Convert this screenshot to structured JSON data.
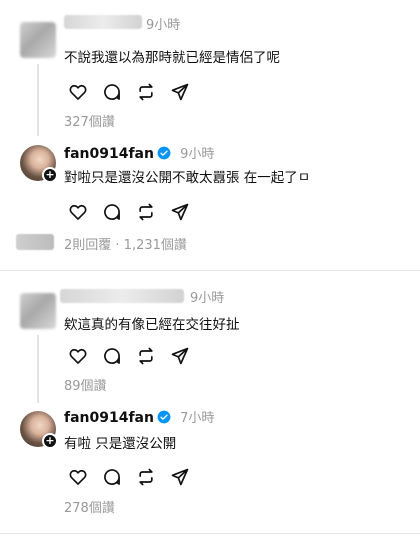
{
  "comments": [
    {
      "time": "9小時",
      "text": "不說我還以為那時就已經是情侶了呢",
      "likes": "327個讚"
    },
    {
      "username": "fan0914fan",
      "time": "9小時",
      "text": "對啦只是還沒公開不敢太囂張 在一起了ㅁ",
      "likes": ""
    },
    {
      "time": "9小時",
      "text": "欸這真的有像已經在交往好扯",
      "likes": "89個讚"
    },
    {
      "username": "fan0914fan",
      "time": "7小時",
      "text": "有啦 只是還沒公開",
      "likes": "278個讚"
    }
  ],
  "replies_summary": "2則回覆 · 1,231個讚",
  "icons": {
    "like": "heart-icon",
    "comment": "comment-icon",
    "repost": "repost-icon",
    "share": "send-icon",
    "verified": "verified-badge-icon",
    "follow": "plus-icon"
  },
  "colors": {
    "verified": "#0095f6",
    "meta": "#999999",
    "text": "#101010"
  }
}
